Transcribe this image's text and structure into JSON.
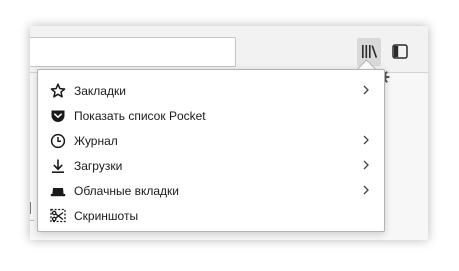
{
  "toolbar": {
    "url_value": "",
    "library_icon": "library-icon",
    "sidebar_icon": "sidebar-icon"
  },
  "page": {
    "gear_icon": "gear-icon"
  },
  "library_menu": {
    "items": [
      {
        "label": "Закладки",
        "icon": "star-icon",
        "has_submenu": true
      },
      {
        "label": "Показать список Pocket",
        "icon": "pocket-icon",
        "has_submenu": false
      },
      {
        "label": "Журнал",
        "icon": "clock-icon",
        "has_submenu": true
      },
      {
        "label": "Загрузки",
        "icon": "download-icon",
        "has_submenu": true
      },
      {
        "label": "Облачные вкладки",
        "icon": "synced-tabs-icon",
        "has_submenu": true
      },
      {
        "label": "Скриншоты",
        "icon": "screenshot-icon",
        "has_submenu": false
      }
    ]
  },
  "colors": {
    "menu_background": "#ffffff",
    "toolbar_background": "#f2f2f2",
    "active_button": "#d9d9d9",
    "icon_color": "#1a1a1a"
  }
}
